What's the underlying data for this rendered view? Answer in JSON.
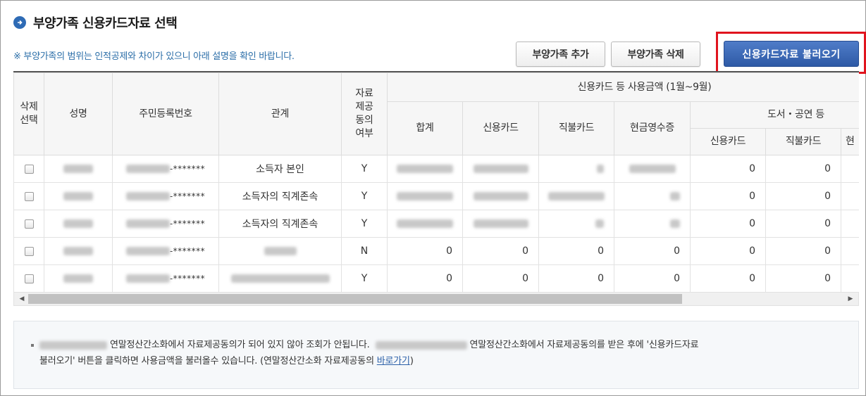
{
  "header": {
    "title": "부양가족 신용카드자료 선택",
    "notice": "※ 부양가족의 범위는 인적공제와 차이가 있으니 아래 설명을 확인 바랍니다."
  },
  "buttons": {
    "add_label": "부양가족 추가",
    "delete_label": "부양가족 삭제",
    "load_label": "신용카드자료 불러오기"
  },
  "table": {
    "headers": {
      "delete_select": "삭제\n선택",
      "name": "성명",
      "resident_no": "주민등록번호",
      "relation": "관계",
      "consent": "자료\n제공\n동의\n여부",
      "usage_group": "신용카드 등 사용금액 (1월~9월)",
      "total": "합계",
      "credit_card": "신용카드",
      "debit_card": "직불카드",
      "cash_receipt": "현금영수증",
      "books_group": "도서・공연 등",
      "books_credit": "신용카드",
      "books_debit": "직불카드",
      "books_cash": "현"
    },
    "rows": [
      {
        "resident_suffix": "-*******",
        "relation": "소득자 본인",
        "consent": "Y",
        "total": "",
        "credit": "",
        "debit": "",
        "cash": "",
        "books_credit": "0",
        "books_debit": "0"
      },
      {
        "resident_suffix": "-*******",
        "relation": "소득자의 직계존속",
        "consent": "Y",
        "total": "",
        "credit": "",
        "debit": "",
        "cash": "",
        "books_credit": "0",
        "books_debit": "0"
      },
      {
        "resident_suffix": "-*******",
        "relation": "소득자의 직계존속",
        "consent": "Y",
        "total": "",
        "credit": "",
        "debit": "",
        "cash": "",
        "books_credit": "0",
        "books_debit": "0"
      },
      {
        "resident_suffix": "-*******",
        "relation": "",
        "consent": "N",
        "total": "0",
        "credit": "0",
        "debit": "0",
        "cash": "0",
        "books_credit": "0",
        "books_debit": "0"
      },
      {
        "resident_suffix": "-*******",
        "relation": "",
        "consent": "Y",
        "total": "0",
        "credit": "0",
        "debit": "0",
        "cash": "0",
        "books_credit": "0",
        "books_debit": "0"
      }
    ]
  },
  "info": {
    "part1": "연말정산간소화에서 자료제공동의가 되어 있지 않아 조회가 안됩니다.",
    "part2": "연말정산간소화에서 자료제공동의를 받은 후에 '신용카드자료",
    "part3": "불러오기' 버튼을 클릭하면 사용금액을 불러올수 있습니다. (연말정산간소화 자료제공동의",
    "link": "바로가기",
    "close_paren": ")"
  },
  "colors": {
    "accent": "#2e5aa6",
    "highlight": "#e0141e",
    "notice": "#2b6ea8"
  }
}
